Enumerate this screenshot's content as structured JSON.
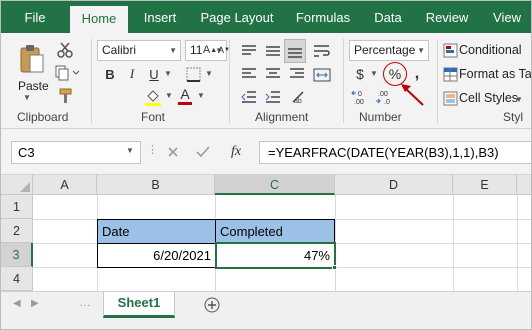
{
  "ribbon_tabs": [
    "File",
    "Home",
    "Insert",
    "Page Layout",
    "Formulas",
    "Data",
    "Review",
    "View"
  ],
  "active_tab": "Home",
  "clipboard": {
    "paste_label": "Paste",
    "group_label": "Clipboard"
  },
  "font": {
    "name": "Calibri",
    "size": "11",
    "bold": "B",
    "italic": "I",
    "underline": "U",
    "font_color_glyph": "A",
    "group_label": "Font"
  },
  "alignment": {
    "group_label": "Alignment"
  },
  "number": {
    "format": "Percentage",
    "currency_symbol": "$",
    "percent_symbol": "%",
    "comma_symbol": ",",
    "group_label": "Number"
  },
  "styles": {
    "conditional_label": "Conditional",
    "format_as_table_label": "Format as Ta",
    "cell_styles_label": "Cell Styles",
    "group_label": "Styl"
  },
  "formula_bar": {
    "name_box": "C3",
    "fx_label": "fx",
    "formula": "=YEARFRAC(DATE(YEAR(B3),1,1),B3)"
  },
  "columns": [
    "A",
    "B",
    "C",
    "D",
    "E"
  ],
  "selected_column": "C",
  "rows": [
    "1",
    "2",
    "3",
    "4"
  ],
  "selected_row": "3",
  "cells": {
    "B2": "Date",
    "C2": "Completed",
    "B3": "6/20/2021",
    "C3": "47%"
  },
  "header_fill_color": "#9bc2e6",
  "accent_color": "#217346",
  "annotation_color": "#c00000",
  "sheet_tab": "Sheet1"
}
